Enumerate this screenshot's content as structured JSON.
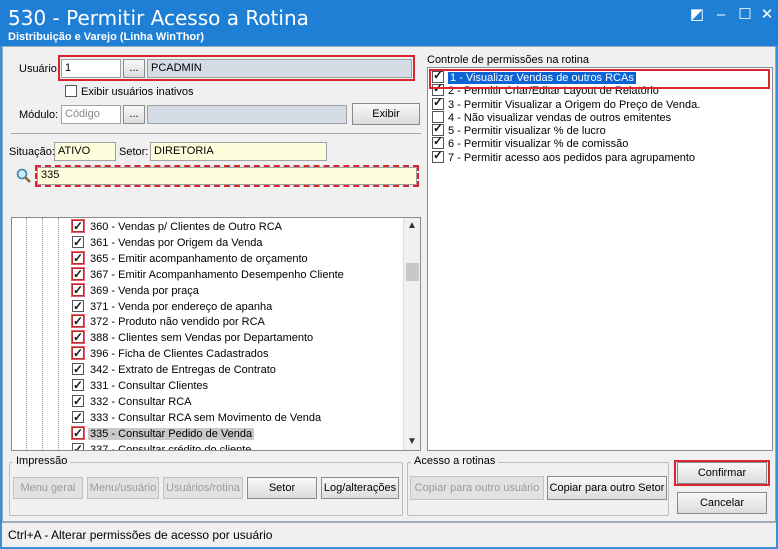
{
  "window": {
    "title": "530 - Permitir Acesso a Rotina",
    "subtitle": "Distribuição e Varejo (Linha WinThor)",
    "controls": [
      "◩",
      "–",
      "☐",
      "✕"
    ]
  },
  "user": {
    "label": "Usuário:",
    "value": "1",
    "lookup": "...",
    "name": "PCADMIN"
  },
  "show_inactive": {
    "label": "Exibir usuários inativos",
    "checked": false
  },
  "module": {
    "label": "Módulo:",
    "placeholder": "Código",
    "lookup": "...",
    "name": "",
    "show_button": "Exibir"
  },
  "situation": {
    "label": "Situação:",
    "value": "ATIVO"
  },
  "sector": {
    "label": "Setor:",
    "value": "DIRETORIA"
  },
  "search": {
    "value": "335"
  },
  "routines": [
    {
      "label": "360 - Vendas p/ Clientes de Outro RCA",
      "checked": true,
      "red": true
    },
    {
      "label": "361 - Vendas por Origem da Venda",
      "checked": true,
      "red": false
    },
    {
      "label": "365 - Emitir acompanhamento de orçamento",
      "checked": true,
      "red": true
    },
    {
      "label": "367 - Emitir Acompanhamento Desempenho Cliente",
      "checked": true,
      "red": true
    },
    {
      "label": "369 - Venda por praça",
      "checked": true,
      "red": true
    },
    {
      "label": "371 - Venda por endereço de apanha",
      "checked": true,
      "red": false
    },
    {
      "label": "372 - Produto não vendido por RCA",
      "checked": true,
      "red": true
    },
    {
      "label": "388 - Clientes sem Vendas por Departamento",
      "checked": true,
      "red": true
    },
    {
      "label": "396 - Ficha de Clientes Cadastrados",
      "checked": true,
      "red": true
    },
    {
      "label": "342 - Extrato de Entregas de Contrato",
      "checked": true,
      "red": false
    },
    {
      "label": "331 - Consultar Clientes",
      "checked": true,
      "red": false
    },
    {
      "label": "332 - Consultar RCA",
      "checked": true,
      "red": false
    },
    {
      "label": "333 - Consultar RCA sem Movimento de Venda",
      "checked": true,
      "red": false
    },
    {
      "label": "335 - Consultar Pedido de Venda",
      "checked": true,
      "red": true,
      "selected": true
    },
    {
      "label": "337 - Consultar crédito do cliente",
      "checked": true,
      "red": false
    }
  ],
  "permissions": {
    "title": "Controle de permissões na rotina",
    "items": [
      {
        "label": "1 - Visualizar Vendas de outros RCAs",
        "checked": true,
        "selected": true
      },
      {
        "label": "2 - Permitir Criar/Editar Layout de Relatório",
        "checked": true
      },
      {
        "label": "3 - Permitir Visualizar a Origem do Preço de Venda.",
        "checked": true
      },
      {
        "label": "4 - Não visualizar vendas de outros emitentes",
        "checked": false
      },
      {
        "label": "5 - Permitir visualizar % de lucro",
        "checked": true
      },
      {
        "label": "6 - Permitir visualizar % de comissão",
        "checked": true
      },
      {
        "label": "7 - Permitir acesso aos pedidos para agrupamento",
        "checked": true
      }
    ]
  },
  "print_group": {
    "title": "Impressão",
    "buttons": [
      "Menu geral",
      "Menu/usuário",
      "Usuários/rotina",
      "Setor",
      "Log/alterações"
    ]
  },
  "access_group": {
    "title": "Acesso a rotinas",
    "buttons": [
      "Copiar para outro usuário",
      "Copiar para outro Setor"
    ]
  },
  "actions": {
    "confirm": "Confirmar",
    "cancel": "Cancelar"
  },
  "status": "Ctrl+A - Alterar permissões de acesso por usuário",
  "colors": {
    "title_bar": "#1f7fd4",
    "highlight_red": "#d9262e",
    "selection_blue": "#0a64d6"
  }
}
